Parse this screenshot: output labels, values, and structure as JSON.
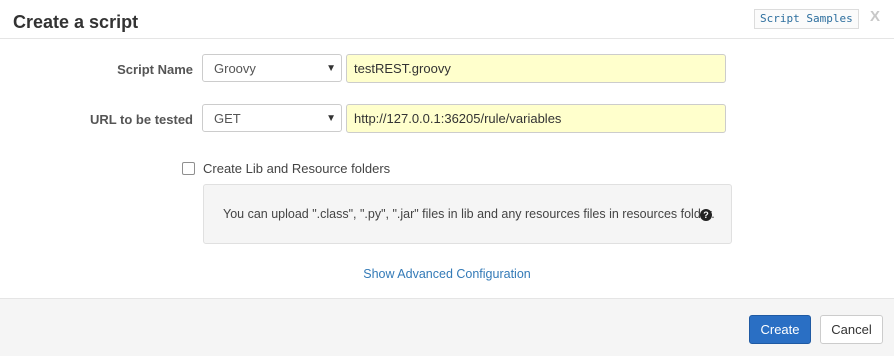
{
  "dialog": {
    "title": "Create a script",
    "samples_link": "Script Samples",
    "close_label": "X"
  },
  "form": {
    "script_name": {
      "label": "Script Name",
      "language": "Groovy",
      "value": "testREST.groovy"
    },
    "url": {
      "label": "URL to be tested",
      "method": "GET",
      "value": "http://127.0.0.1:36205/rule/variables"
    },
    "create_folders": {
      "label": "Create Lib and Resource folders",
      "checked": false
    },
    "info": {
      "text": "You can upload \".class\", \".py\", \".jar\" files in lib and any resources files in resources folder.",
      "help_icon": "?"
    },
    "advanced_link": "Show Advanced Configuration"
  },
  "footer": {
    "create_label": "Create",
    "cancel_label": "Cancel"
  },
  "colors": {
    "primary": "#2a6fc4",
    "link": "#337ab7",
    "input_highlight": "#ffffcc"
  }
}
